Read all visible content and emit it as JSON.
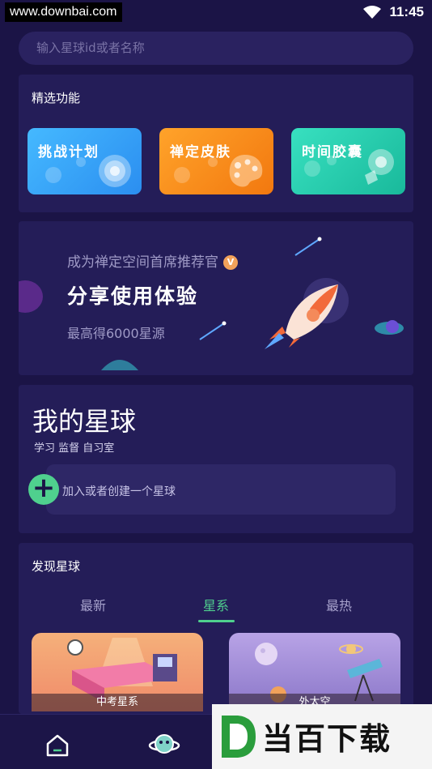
{
  "status_bar": {
    "watermark": "www.downbai.com",
    "time": "11:45"
  },
  "search": {
    "placeholder": "输入星球id或者名称"
  },
  "featured": {
    "title": "精选功能",
    "items": [
      {
        "label": "挑战计划",
        "icon": "target-icon",
        "color": "#3ea8f7"
      },
      {
        "label": "禅定皮肤",
        "icon": "palette-icon",
        "color": "#f7931f"
      },
      {
        "label": "时间胶囊",
        "icon": "capsule-icon",
        "color": "#2fd1b3"
      }
    ]
  },
  "promo": {
    "subtitle": "成为禅定空间首席推荐官",
    "badge": "V",
    "headline": "分享使用体验",
    "reward": "最高得6000星源"
  },
  "my_planet": {
    "title": "我的星球",
    "tags": "学习 监督 自习室",
    "join_text": "加入或者创建一个星球"
  },
  "discover": {
    "title": "发现星球",
    "tabs": [
      "最新",
      "星系",
      "最热"
    ],
    "active_tab": "星系",
    "galaxies": [
      {
        "name": "中考星系"
      },
      {
        "name": "外太空"
      }
    ]
  },
  "bottom_nav": {
    "items": [
      "home-icon",
      "planet-icon"
    ]
  },
  "watermark_bottom": {
    "logo": "D",
    "text": "当百下载"
  },
  "colors": {
    "background": "#1b1446",
    "card": "#241d58",
    "accent": "#4fd08e"
  }
}
